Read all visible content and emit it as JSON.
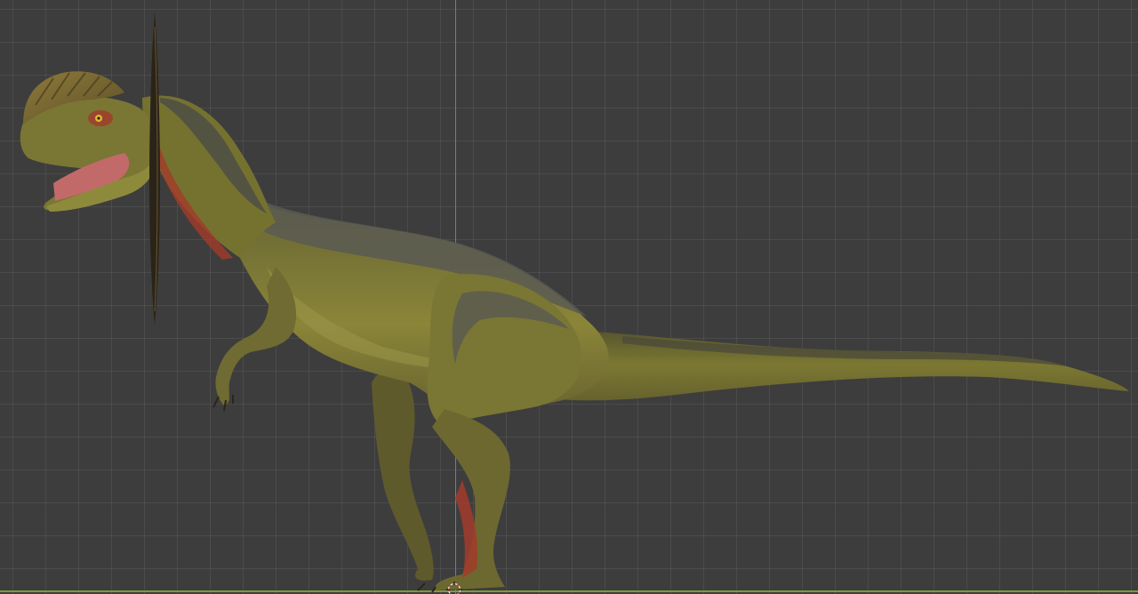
{
  "viewport": {
    "grid_visible": true,
    "background_color": "#3d3d3d",
    "grid_color": "#4a4a4a",
    "axes": {
      "z_axis_color": "#5a7fbf",
      "y_axis_color": "#7f9a3a"
    }
  },
  "scene": {
    "objects": [
      {
        "name": "dilophosaurus-model",
        "icon": "dinosaur-model"
      },
      {
        "name": "plane-object",
        "icon": "plane-edge"
      },
      {
        "name": "3d-cursor",
        "icon": "origin-cursor-icon"
      }
    ],
    "model_colors": {
      "skin_base": "#7d7a30",
      "skin_dark": "#4e4a2a",
      "stripe": "#5a5a52",
      "belly": "#9a9447",
      "mouth": "#c26a6a",
      "wattle": "#a23b2b"
    }
  }
}
